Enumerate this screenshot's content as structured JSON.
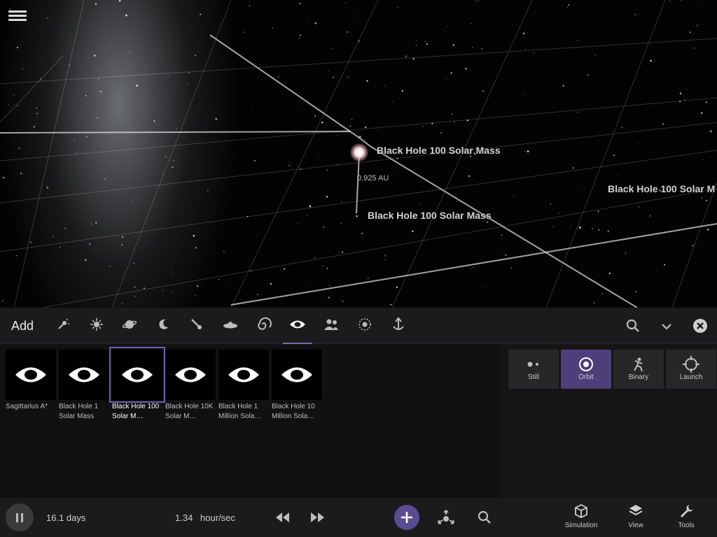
{
  "viewport": {
    "labels": {
      "black_hole_top": "Black Hole 100 Solar Mass",
      "black_hole_mid": "Black Hole 100 Solar Mass",
      "black_hole_right": "Black Hole 100 Solar M",
      "distance": "0.925 AU"
    },
    "icons": {
      "menu": "hamburger-menu-icon"
    }
  },
  "add_bar": {
    "title": "Add",
    "categories": [
      {
        "name": "spacecraft",
        "icon": "sparkle-icon"
      },
      {
        "name": "star",
        "icon": "star-icon"
      },
      {
        "name": "planet",
        "icon": "ringed-planet-icon"
      },
      {
        "name": "moon",
        "icon": "moon-icon"
      },
      {
        "name": "comet",
        "icon": "comet-icon"
      },
      {
        "name": "ufo",
        "icon": "ufo-icon"
      },
      {
        "name": "galaxy",
        "icon": "spiral-galaxy-icon"
      },
      {
        "name": "black-hole",
        "icon": "black-hole-eye-icon",
        "active": true
      },
      {
        "name": "people",
        "icon": "people-icon"
      },
      {
        "name": "ring",
        "icon": "dotted-ring-icon"
      },
      {
        "name": "launch",
        "icon": "anchor-launch-icon"
      }
    ],
    "icons": {
      "search": "search-icon",
      "dropdown": "chevron-down-icon",
      "close": "close-circle-icon"
    }
  },
  "objects": [
    {
      "label": "Sagittarius A*",
      "selected": false
    },
    {
      "label": "Black Hole 1 Solar Mass",
      "selected": false
    },
    {
      "label": "Black Hole 100 Solar M…",
      "selected": true
    },
    {
      "label": "Black Hole 10K Solar M…",
      "selected": false
    },
    {
      "label": "Black Hole 1 Million Sola…",
      "selected": false
    },
    {
      "label": "Black Hole 10 Million Sola…",
      "selected": false
    }
  ],
  "modes": [
    {
      "label": "Still",
      "icon": "still-dots-icon",
      "active": false
    },
    {
      "label": "Orbit",
      "icon": "orbit-icon",
      "active": true
    },
    {
      "label": "Binary",
      "icon": "binary-figure-icon",
      "active": false
    },
    {
      "label": "Launch",
      "icon": "crosshair-icon",
      "active": false
    }
  ],
  "bottom": {
    "time": "16.1 days",
    "rate_value": "1.34",
    "rate_unit": "hour/sec",
    "nav": [
      {
        "label": "Simulation",
        "icon": "cube-icon"
      },
      {
        "label": "View",
        "icon": "layers-icon"
      },
      {
        "label": "Tools",
        "icon": "wrench-icon"
      }
    ]
  },
  "colors": {
    "accent": "#5a4c93",
    "selection": "#6f5fae",
    "panel": "#111112",
    "bar": "#1b1b1d"
  }
}
